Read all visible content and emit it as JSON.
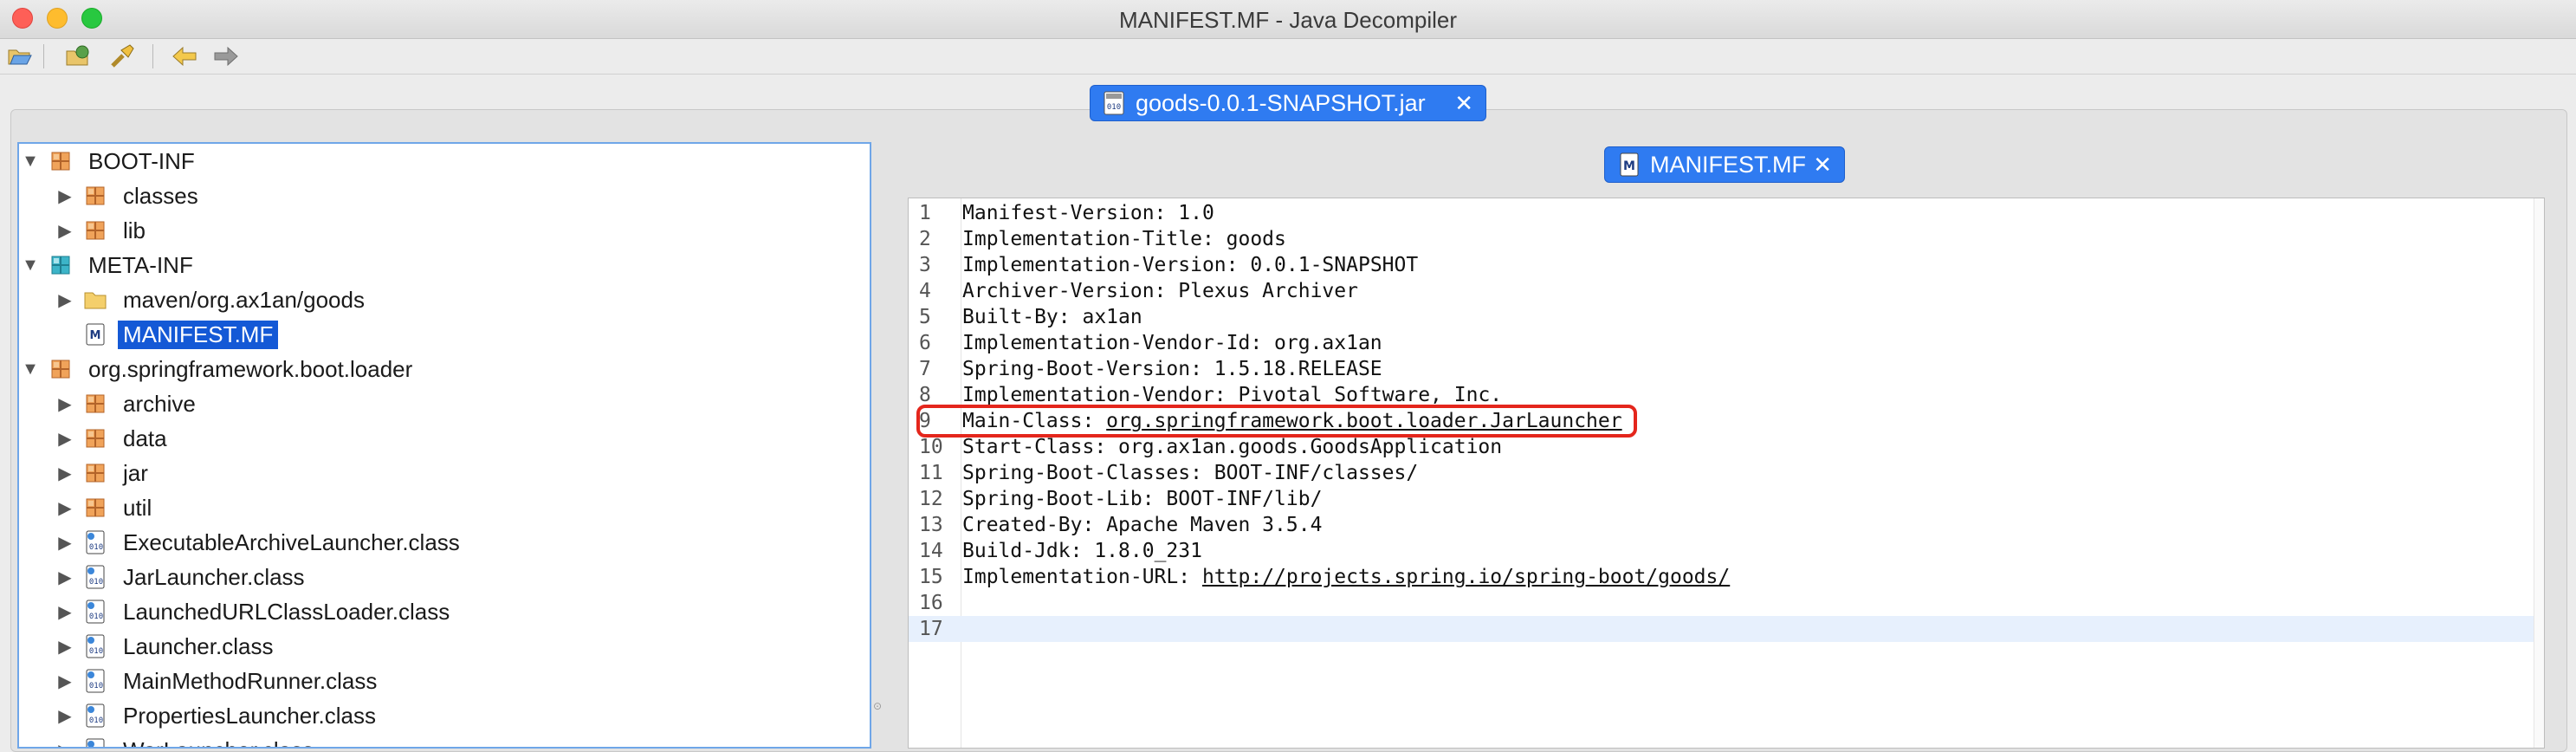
{
  "window": {
    "title": "MANIFEST.MF - Java Decompiler"
  },
  "toolbar": {
    "buttons": [
      "open-file",
      "open-type",
      "search",
      "back",
      "forward"
    ]
  },
  "tabs": {
    "jar": {
      "label": "goods-0.0.1-SNAPSHOT.jar",
      "close": "✕"
    },
    "file": {
      "label": "MANIFEST.MF",
      "close": "✕"
    }
  },
  "tree": {
    "items": [
      {
        "label": "BOOT-INF",
        "icon": "package-icon",
        "expanded": true
      },
      {
        "label": "classes",
        "icon": "package-icon"
      },
      {
        "label": "lib",
        "icon": "package-icon"
      },
      {
        "label": "META-INF",
        "icon": "package-icon",
        "expanded": true
      },
      {
        "label": "maven/org.ax1an/goods",
        "icon": "folder-icon"
      },
      {
        "label": "MANIFEST.MF",
        "icon": "manifest-file-icon",
        "selected": true
      },
      {
        "label": "org.springframework.boot.loader",
        "icon": "package-icon",
        "expanded": true
      },
      {
        "label": "archive",
        "icon": "package-icon"
      },
      {
        "label": "data",
        "icon": "package-icon"
      },
      {
        "label": "jar",
        "icon": "package-icon"
      },
      {
        "label": "util",
        "icon": "package-icon"
      },
      {
        "label": "ExecutableArchiveLauncher.class",
        "icon": "class-file-icon"
      },
      {
        "label": "JarLauncher.class",
        "icon": "class-file-icon"
      },
      {
        "label": "LaunchedURLClassLoader.class",
        "icon": "class-file-icon"
      },
      {
        "label": "Launcher.class",
        "icon": "class-file-icon"
      },
      {
        "label": "MainMethodRunner.class",
        "icon": "class-file-icon"
      },
      {
        "label": "PropertiesLauncher.class",
        "icon": "class-file-icon"
      },
      {
        "label": "WarLauncher.class",
        "icon": "class-file-icon"
      }
    ]
  },
  "editor": {
    "lines": [
      {
        "n": "1",
        "key": "Manifest-Version: ",
        "value": "1.0"
      },
      {
        "n": "2",
        "key": "Implementation-Title: ",
        "value": "goods"
      },
      {
        "n": "3",
        "key": "Implementation-Version: ",
        "value": "0.0.1-SNAPSHOT"
      },
      {
        "n": "4",
        "key": "Archiver-Version: ",
        "value": "Plexus Archiver"
      },
      {
        "n": "5",
        "key": "Built-By: ",
        "value": "ax1an"
      },
      {
        "n": "6",
        "key": "Implementation-Vendor-Id: ",
        "value": "org.ax1an"
      },
      {
        "n": "7",
        "key": "Spring-Boot-Version: ",
        "value": "1.5.18.RELEASE"
      },
      {
        "n": "8",
        "key": "Implementation-Vendor: ",
        "value": "Pivotal Software, Inc."
      },
      {
        "n": "9",
        "key": "Main-Class: ",
        "value": "org.springframework.boot.loader.JarLauncher",
        "link": true
      },
      {
        "n": "10",
        "key": "Start-Class: ",
        "value": "org.ax1an.goods.GoodsApplication"
      },
      {
        "n": "11",
        "key": "Spring-Boot-Classes: ",
        "value": "BOOT-INF/classes/"
      },
      {
        "n": "12",
        "key": "Spring-Boot-Lib: ",
        "value": "BOOT-INF/lib/"
      },
      {
        "n": "13",
        "key": "Created-By: ",
        "value": "Apache Maven 3.5.4"
      },
      {
        "n": "14",
        "key": "Build-Jdk: ",
        "value": "1.8.0_231"
      },
      {
        "n": "15",
        "key": "Implementation-URL: ",
        "value": "http://projects.spring.io/spring-boot/goods/",
        "link": true
      },
      {
        "n": "16",
        "key": "",
        "value": ""
      },
      {
        "n": "17",
        "key": "",
        "value": "",
        "current": true
      }
    ]
  },
  "colors": {
    "accent": "#2f7bf1",
    "selection": "#1459d6",
    "highlight_box": "#e4261c"
  }
}
